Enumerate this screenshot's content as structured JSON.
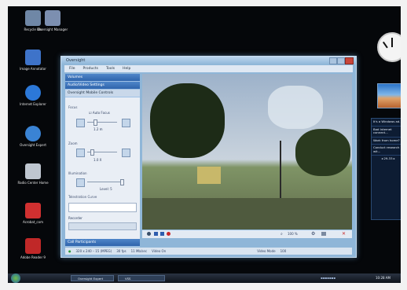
{
  "desktop": {
    "icons": [
      {
        "name": "recycle-bin",
        "label": "Recycle Bin",
        "color": "#6f87a6"
      },
      {
        "name": "manager",
        "label": "Oversight Manager",
        "color": "#7c8fb0"
      },
      {
        "name": "image-annotator",
        "label": "Image Annotator",
        "color": "#3e73c9"
      },
      {
        "name": "internet-explorer",
        "label": "Internet Explorer",
        "color": "#2c78d8"
      },
      {
        "name": "oversight-expert",
        "label": "Oversight Expert",
        "color": "#3a83d4"
      },
      {
        "name": "radio-center",
        "label": "Radio Center Home",
        "color": "#bfc6d0"
      },
      {
        "name": "acrobat",
        "label": "Acrobat_com",
        "color": "#d03030"
      },
      {
        "name": "adobe-reader",
        "label": "Adobe Reader 9",
        "color": "#c02828"
      }
    ]
  },
  "window": {
    "title": "Oversight",
    "menu": [
      "File",
      "Products",
      "Tools",
      "Help"
    ],
    "sections": [
      "Volumes",
      "Audio/Video Settings",
      "Oversight Mobile Controls"
    ],
    "focus": {
      "label": "Focus",
      "auto_focus": "Auto Focus",
      "value": "1.2 m"
    },
    "zoom": {
      "label": "Zoom",
      "value": "1.0 X"
    },
    "illumination": {
      "label": "Illumination",
      "level": "Level: 5"
    },
    "telestration": {
      "label": "Telestration Curve"
    },
    "recorder": "Recorder",
    "bottom_section": "Call Participants",
    "status": [
      "320 x 240 – 15 (MPEG)",
      "30 fps",
      "11 Mb/sec",
      "Video On",
      "Video Mode",
      "100"
    ],
    "zoom_readout": "100 %"
  },
  "sidebar": {
    "news": [
      "It's a Windows ad.",
      "Bad Internet connect...",
      "Work from home?",
      "Conduct research wit..."
    ],
    "pager": "29-33"
  },
  "taskbar": {
    "items": [
      "Oversight Expert",
      "VSS"
    ],
    "time": "10:28 AM"
  },
  "colors": {
    "accent": "#2f64ac",
    "desktop": "#05070a"
  }
}
